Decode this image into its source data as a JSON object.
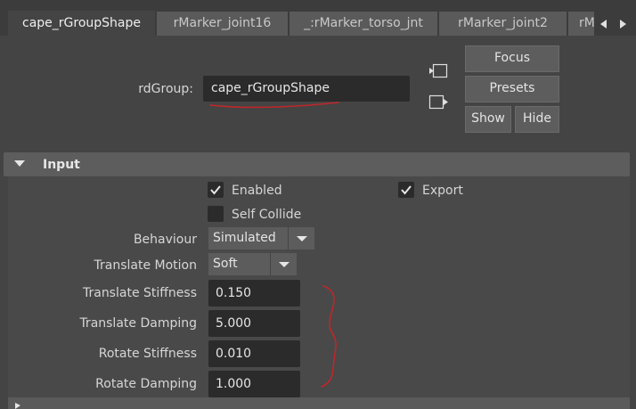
{
  "tabs": [
    {
      "label": "cape_rGroupShape",
      "active": true
    },
    {
      "label": "rMarker_joint16",
      "active": false
    },
    {
      "label": "_:rMarker_torso_jnt",
      "active": false
    },
    {
      "label": "rMarker_joint2",
      "active": false
    },
    {
      "label": "rM",
      "active": false
    }
  ],
  "header": {
    "rdgroup_label": "rdGroup:",
    "rdgroup_value": "cape_rGroupShape",
    "focus_label": "Focus",
    "presets_label": "Presets",
    "show_label": "Show",
    "hide_label": "Hide"
  },
  "section": {
    "title": "Input",
    "enabled_label": "Enabled",
    "enabled_checked": true,
    "export_label": "Export",
    "export_checked": true,
    "self_collide_label": "Self Collide",
    "self_collide_checked": false,
    "behaviour_label": "Behaviour",
    "behaviour_value": "Simulated",
    "translate_motion_label": "Translate Motion",
    "translate_motion_value": "Soft",
    "translate_stiffness_label": "Translate Stiffness",
    "translate_stiffness_value": "0.150",
    "translate_damping_label": "Translate Damping",
    "translate_damping_value": "5.000",
    "rotate_stiffness_label": "Rotate Stiffness",
    "rotate_stiffness_value": "0.010",
    "rotate_damping_label": "Rotate Damping",
    "rotate_damping_value": "1.000"
  },
  "colors": {
    "background": "#444444",
    "field": "#2b2b2b",
    "annotation": "#c0262a"
  }
}
